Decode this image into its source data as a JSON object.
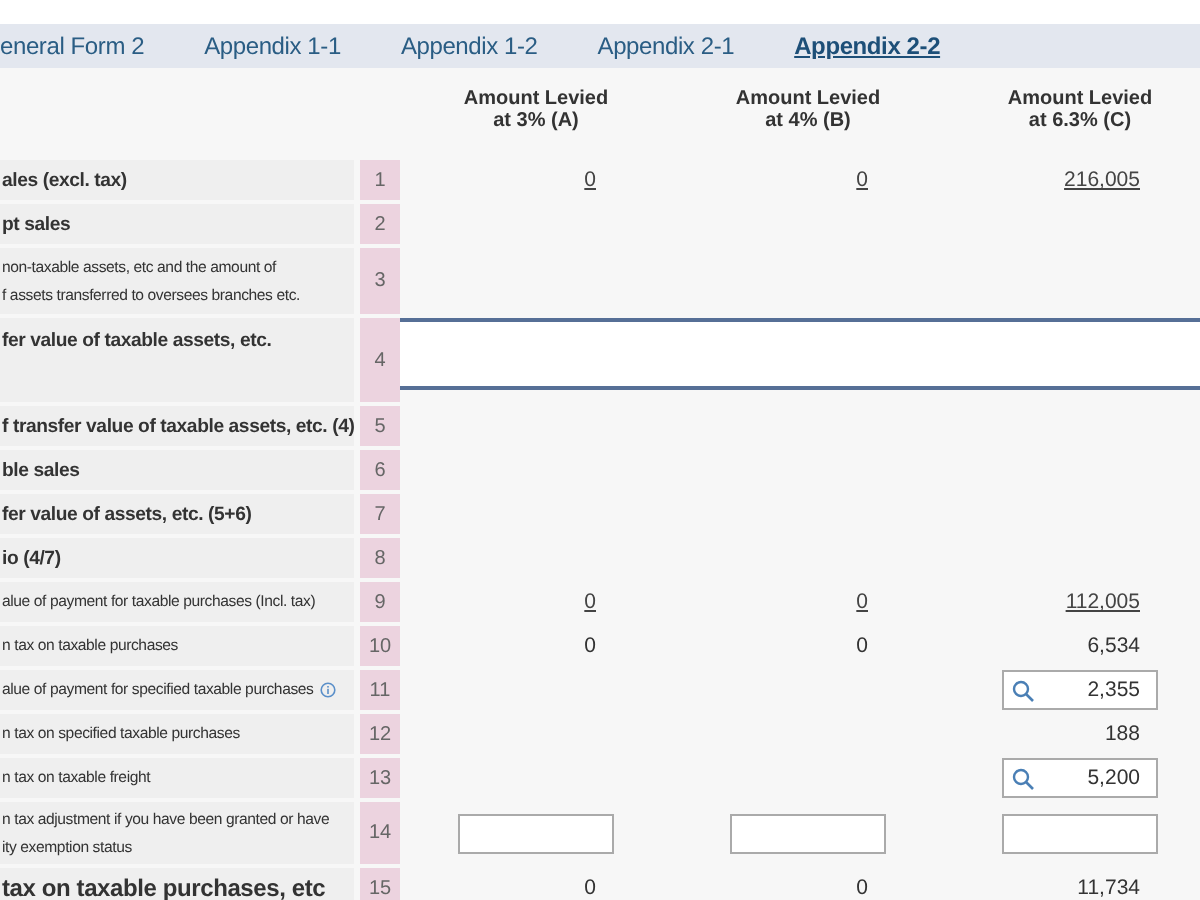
{
  "tabs": [
    {
      "label": "eneral Form 2",
      "selected": false
    },
    {
      "label": "Appendix 1-1",
      "selected": false
    },
    {
      "label": "Appendix 1-2",
      "selected": false
    },
    {
      "label": "Appendix 2-1",
      "selected": false
    },
    {
      "label": "Appendix 2-2",
      "selected": true
    }
  ],
  "columns": [
    "Amount Levied\nat 3% (A)",
    "Amount Levied\nat 4% (B)",
    "Amount Levied\nat 6.3% (C)"
  ],
  "rows": [
    {
      "label": "ales (excl. tax)",
      "kind": "main",
      "number": "1",
      "cells": [
        {
          "kind": "link",
          "value": "0"
        },
        {
          "kind": "link",
          "value": "0"
        },
        {
          "kind": "link",
          "value": "216,005"
        }
      ]
    },
    {
      "label": "pt sales",
      "kind": "main",
      "number": "2"
    },
    {
      "label": "non-taxable assets, etc and the amount of\nf assets transferred to oversees branches etc.",
      "kind": "sub",
      "number": "3"
    },
    {
      "label": "fer value of taxable assets, etc.",
      "kind": "main",
      "number": "4",
      "highlight": true
    },
    {
      "label": "f transfer value of taxable assets, etc. (4)",
      "kind": "main",
      "number": "5"
    },
    {
      "label": "ble sales",
      "kind": "main",
      "number": "6"
    },
    {
      "label": "fer value of assets, etc. (5+6)",
      "kind": "main",
      "number": "7"
    },
    {
      "label": "io (4/7)",
      "kind": "main",
      "number": "8"
    },
    {
      "label": "alue of payment for taxable purchases (Incl. tax)",
      "kind": "sub",
      "number": "9",
      "cells": [
        {
          "kind": "link",
          "value": "0"
        },
        {
          "kind": "link",
          "value": "0"
        },
        {
          "kind": "link",
          "value": "112,005"
        }
      ]
    },
    {
      "label": "n tax on taxable purchases",
      "kind": "sub",
      "number": "10",
      "cells": [
        {
          "kind": "text",
          "value": "0"
        },
        {
          "kind": "text",
          "value": "0"
        },
        {
          "kind": "text",
          "value": "6,534"
        }
      ]
    },
    {
      "label": "alue of payment for specified taxable purchases",
      "kind": "sub",
      "number": "11",
      "info": true,
      "cells": [
        {
          "kind": "empty"
        },
        {
          "kind": "empty"
        },
        {
          "kind": "search_input",
          "value": "2,355"
        }
      ]
    },
    {
      "label": "n tax on specified taxable purchases",
      "kind": "sub",
      "number": "12",
      "cells": [
        {
          "kind": "empty"
        },
        {
          "kind": "empty"
        },
        {
          "kind": "text",
          "value": "188"
        }
      ]
    },
    {
      "label": "n tax on taxable freight",
      "kind": "sub",
      "number": "13",
      "cells": [
        {
          "kind": "empty"
        },
        {
          "kind": "empty"
        },
        {
          "kind": "search_input",
          "value": "5,200"
        }
      ]
    },
    {
      "label": "n tax adjustment if you have been granted or have\nity exemption status",
      "kind": "sub",
      "number": "14",
      "cells": [
        {
          "kind": "input"
        },
        {
          "kind": "input"
        },
        {
          "kind": "input"
        }
      ]
    },
    {
      "label": "tax on taxable purchases, etc",
      "kind": "total",
      "number": "15",
      "cells": [
        {
          "kind": "text",
          "value": "0"
        },
        {
          "kind": "text",
          "value": "0"
        },
        {
          "kind": "text",
          "value": "11,734"
        }
      ]
    }
  ]
}
